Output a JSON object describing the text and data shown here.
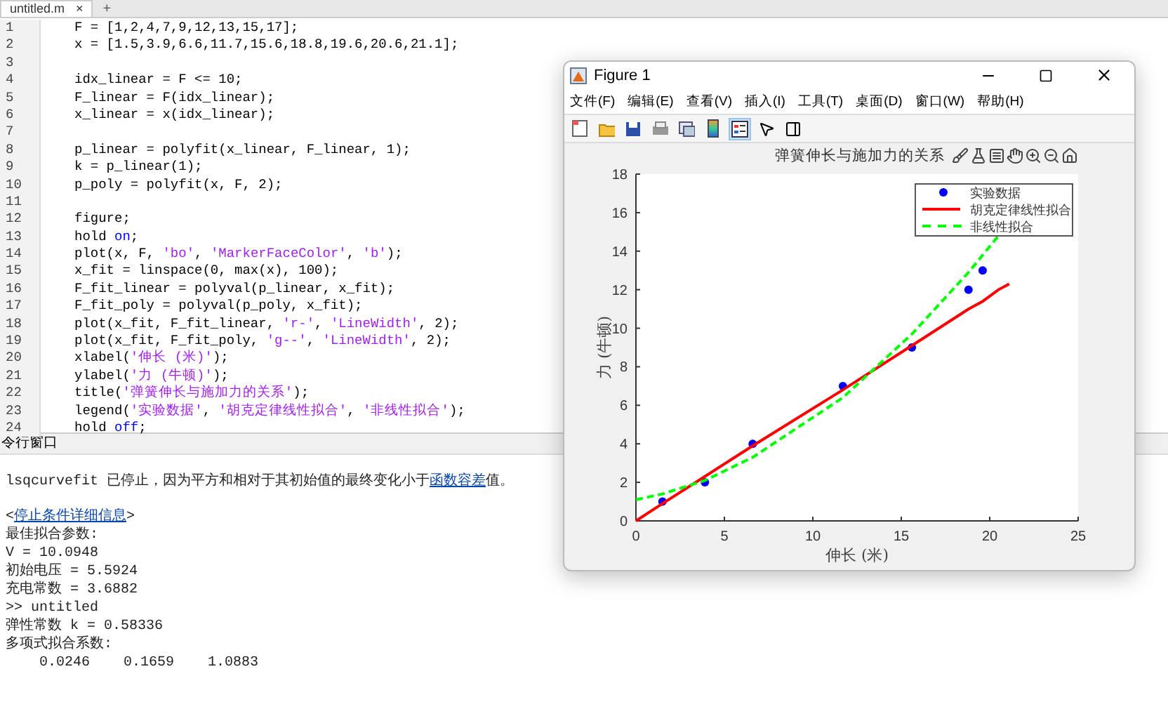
{
  "editor": {
    "tab": {
      "label": "untitled.m",
      "close": "×",
      "add": "+"
    },
    "lines": [
      {
        "number": "1",
        "segments": [
          {
            "kind": "plain",
            "text": "F = [1,2,4,7,9,12,13,15,17];"
          }
        ]
      },
      {
        "number": "2",
        "segments": [
          {
            "kind": "plain",
            "text": "x = [1.5,3.9,6.6,11.7,15.6,18.8,19.6,20.6,21.1];"
          }
        ]
      },
      {
        "number": "3"
      },
      {
        "number": "4",
        "segments": [
          {
            "kind": "plain",
            "text": "idx_linear = F <= 10;"
          }
        ]
      },
      {
        "number": "5",
        "segments": [
          {
            "kind": "plain",
            "text": "F_linear = F(idx_linear);"
          }
        ]
      },
      {
        "number": "6",
        "segments": [
          {
            "kind": "plain",
            "text": "x_linear = x(idx_linear);"
          }
        ]
      },
      {
        "number": "7"
      },
      {
        "number": "8",
        "segments": [
          {
            "kind": "plain",
            "text": "p_linear = polyfit(x_linear, F_linear, 1);"
          }
        ]
      },
      {
        "number": "9",
        "segments": [
          {
            "kind": "plain",
            "text": "k = p_linear(1);"
          }
        ]
      },
      {
        "number": "10",
        "segments": [
          {
            "kind": "plain",
            "text": "p_poly = polyfit(x, F, 2);"
          }
        ]
      },
      {
        "number": "11"
      },
      {
        "number": "12",
        "segments": [
          {
            "kind": "plain",
            "text": "figure;"
          }
        ]
      },
      {
        "number": "13",
        "segments": [
          {
            "kind": "plain",
            "text": "hold "
          },
          {
            "kind": "keyword",
            "text": "on"
          },
          {
            "kind": "plain",
            "text": ";"
          }
        ]
      },
      {
        "number": "14",
        "segments": [
          {
            "kind": "plain",
            "text": "plot(x, F, "
          },
          {
            "kind": "string",
            "text": "'bo'"
          },
          {
            "kind": "plain",
            "text": ", "
          },
          {
            "kind": "string",
            "text": "'MarkerFaceColor'"
          },
          {
            "kind": "plain",
            "text": ", "
          },
          {
            "kind": "string",
            "text": "'b'"
          },
          {
            "kind": "plain",
            "text": ");"
          }
        ]
      },
      {
        "number": "15",
        "segments": [
          {
            "kind": "plain",
            "text": "x_fit = linspace(0, max(x), 100);"
          }
        ]
      },
      {
        "number": "16",
        "segments": [
          {
            "kind": "plain",
            "text": "F_fit_linear = polyval(p_linear, x_fit);"
          }
        ]
      },
      {
        "number": "17",
        "segments": [
          {
            "kind": "plain",
            "text": "F_fit_poly = polyval(p_poly, x_fit);"
          }
        ]
      },
      {
        "number": "18",
        "segments": [
          {
            "kind": "plain",
            "text": "plot(x_fit, F_fit_linear, "
          },
          {
            "kind": "string",
            "text": "'r-'"
          },
          {
            "kind": "plain",
            "text": ", "
          },
          {
            "kind": "string",
            "text": "'LineWidth'"
          },
          {
            "kind": "plain",
            "text": ", 2);"
          }
        ]
      },
      {
        "number": "19",
        "segments": [
          {
            "kind": "plain",
            "text": "plot(x_fit, F_fit_poly, "
          },
          {
            "kind": "string",
            "text": "'g--'"
          },
          {
            "kind": "plain",
            "text": ", "
          },
          {
            "kind": "string",
            "text": "'LineWidth'"
          },
          {
            "kind": "plain",
            "text": ", 2);"
          }
        ]
      },
      {
        "number": "20",
        "segments": [
          {
            "kind": "plain",
            "text": "xlabel("
          },
          {
            "kind": "string",
            "text": "'伸长 (米)'"
          },
          {
            "kind": "plain",
            "text": ");"
          }
        ]
      },
      {
        "number": "21",
        "segments": [
          {
            "kind": "plain",
            "text": "ylabel("
          },
          {
            "kind": "string",
            "text": "'力 (牛顿)'"
          },
          {
            "kind": "plain",
            "text": ");"
          }
        ]
      },
      {
        "number": "22",
        "segments": [
          {
            "kind": "plain",
            "text": "title("
          },
          {
            "kind": "string",
            "text": "'弹簧伸长与施加力的关系'"
          },
          {
            "kind": "plain",
            "text": ");"
          }
        ]
      },
      {
        "number": "23",
        "segments": [
          {
            "kind": "plain",
            "text": "legend("
          },
          {
            "kind": "string",
            "text": "'实验数据'"
          },
          {
            "kind": "plain",
            "text": ", "
          },
          {
            "kind": "string",
            "text": "'胡克定律线性拟合'"
          },
          {
            "kind": "plain",
            "text": ", "
          },
          {
            "kind": "string",
            "text": "'非线性拟合'"
          },
          {
            "kind": "plain",
            "text": ");"
          }
        ]
      },
      {
        "number": "24",
        "segments": [
          {
            "kind": "plain",
            "text": "hold "
          },
          {
            "kind": "keyword",
            "text": "off"
          },
          {
            "kind": "plain",
            "text": ";"
          }
        ]
      }
    ]
  },
  "command_window": {
    "title": "令行窗口",
    "lines": [
      {
        "segments": [
          {
            "kind": "plain",
            "text": "lsqcurvefit 已停止，因为平方和相对于其初始值的最终变化小于"
          },
          {
            "kind": "link",
            "text": "函数容差"
          },
          {
            "kind": "plain",
            "text": "值。"
          }
        ]
      },
      {
        "blank_before": true,
        "segments": [
          {
            "kind": "plain",
            "text": "<"
          },
          {
            "kind": "link",
            "text": "停止条件详细信息"
          },
          {
            "kind": "plain",
            "text": ">"
          }
        ]
      },
      {
        "segments": [
          {
            "kind": "plain",
            "text": "最佳拟合参数:"
          }
        ]
      },
      {
        "segments": [
          {
            "kind": "plain",
            "text": "V = 10.0948"
          }
        ]
      },
      {
        "segments": [
          {
            "kind": "plain",
            "text": "初始电压 = 5.5924"
          }
        ]
      },
      {
        "segments": [
          {
            "kind": "plain",
            "text": "充电常数 = 3.6882"
          }
        ]
      },
      {
        "segments": [
          {
            "kind": "plain",
            "text": ">> untitled"
          }
        ]
      },
      {
        "segments": [
          {
            "kind": "plain",
            "text": "弹性常数 k = 0.58336"
          }
        ]
      },
      {
        "segments": [
          {
            "kind": "plain",
            "text": "多项式拟合系数:"
          }
        ]
      },
      {
        "segments": [
          {
            "kind": "plain",
            "text": "    0.0246    0.1659    1.0883"
          }
        ]
      }
    ]
  },
  "figure": {
    "title": "Figure 1",
    "menu": [
      "文件(F)",
      "编辑(E)",
      "查看(V)",
      "插入(I)",
      "工具(T)",
      "桌面(D)",
      "窗口(W)",
      "帮助(H)"
    ],
    "toolbar": [
      {
        "kind": "new",
        "selected": false
      },
      {
        "kind": "open",
        "selected": false
      },
      {
        "kind": "save",
        "selected": false
      },
      {
        "kind": "print",
        "selected": false
      },
      {
        "kind": "link",
        "selected": false
      },
      {
        "kind": "colorbar",
        "selected": false
      },
      {
        "kind": "legend",
        "selected": true
      },
      {
        "kind": "pointer",
        "selected": false
      },
      {
        "kind": "panel",
        "selected": false
      }
    ],
    "axes_title": "弹簧伸长与施加力的关系",
    "chart_data": {
      "type": "scatter",
      "xlabel": "伸长 (米)",
      "ylabel": "力 (牛顿)",
      "legend": "upper right",
      "x": [
        0,
        1.5,
        3.9,
        6.6,
        11.7,
        15.6,
        18.8,
        19.6,
        20.5,
        21.1
      ],
      "series": [
        {
          "name": "实验数据",
          "color": "#0000ff",
          "marker": "circle",
          "values": [
            null,
            1,
            2,
            4,
            7,
            9,
            12,
            13,
            null,
            null
          ]
        },
        {
          "name": "胡克定律线性拟合",
          "color": "#ff0000",
          "type": "line",
          "line_style": "solid",
          "marker": "none",
          "values": [
            0,
            0.9,
            2.3,
            3.9,
            6.8,
            9.1,
            11.0,
            11.4,
            12.0,
            12.3
          ]
        },
        {
          "name": "非线性拟合",
          "color": "#00ff00",
          "type": "line",
          "line_style": "dashed",
          "marker": "none",
          "values": [
            1.1,
            1.4,
            2.1,
            3.3,
            6.4,
            9.7,
            12.9,
            13.8,
            14.8,
            null
          ]
        }
      ],
      "xlim": [
        0,
        25
      ],
      "ylim": [
        0,
        18
      ],
      "xticks": [
        0,
        5,
        10,
        15,
        20,
        25
      ],
      "yticks": [
        0,
        2,
        4,
        6,
        8,
        10,
        12,
        14,
        16,
        18
      ]
    }
  }
}
